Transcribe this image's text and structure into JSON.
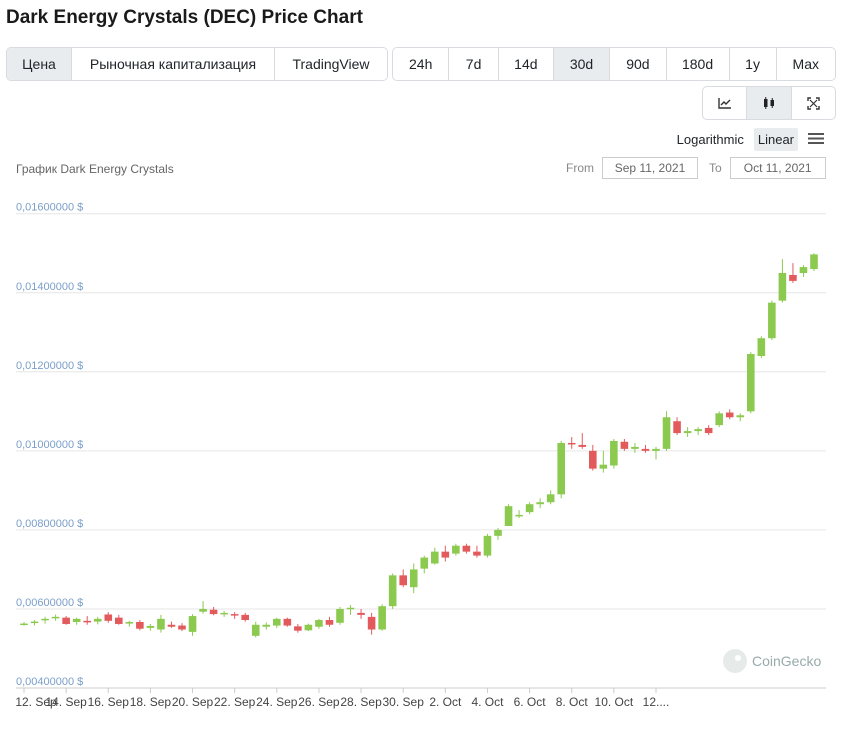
{
  "page": {
    "title": "Dark Energy Crystals (DEC) Price Chart"
  },
  "toolbar": {
    "data_tabs": [
      {
        "label": "Цена",
        "active": true
      },
      {
        "label": "Рыночная капитализация",
        "active": false
      },
      {
        "label": "TradingView",
        "active": false
      }
    ],
    "ranges": [
      {
        "label": "24h",
        "active": false
      },
      {
        "label": "7d",
        "active": false
      },
      {
        "label": "14d",
        "active": false
      },
      {
        "label": "30d",
        "active": true
      },
      {
        "label": "90d",
        "active": false
      },
      {
        "label": "180d",
        "active": false
      },
      {
        "label": "1y",
        "active": false
      },
      {
        "label": "Max",
        "active": false
      }
    ],
    "views": [
      {
        "icon": "line-chart-icon",
        "active": false
      },
      {
        "icon": "candlestick-icon",
        "active": true
      },
      {
        "icon": "fullscreen-icon",
        "active": false
      }
    ],
    "scale": {
      "log_label": "Logarithmic",
      "linear_label": "Linear",
      "selected": "Linear"
    }
  },
  "chart_header": {
    "label": "График Dark Energy Crystals",
    "from_label": "From",
    "from_value": "Sep 11, 2021",
    "to_label": "To",
    "to_value": "Oct 11, 2021"
  },
  "watermark": "CoinGecko",
  "colors": {
    "up": "#8cc94f",
    "down": "#e35a5d",
    "grid": "#e6e6e6",
    "axis_label": "#7a9ec9"
  },
  "chart_data": {
    "type": "candlestick",
    "yticks": [
      0.004,
      0.006,
      0.008,
      0.01,
      0.012,
      0.014,
      0.016
    ],
    "ytick_labels": [
      "0,00400000 $",
      "0,00600000 $",
      "0,00800000 $",
      "0,01000000 $",
      "0,01200000 $",
      "0,01400000 $",
      "0,01600000 $"
    ],
    "ylim": [
      0.004,
      0.0166
    ],
    "xticks": [
      {
        "i": 0,
        "label": "12. Sep"
      },
      {
        "i": 4,
        "label": "14. Sep"
      },
      {
        "i": 8,
        "label": "16. Sep"
      },
      {
        "i": 12,
        "label": "18. Sep"
      },
      {
        "i": 16,
        "label": "20. Sep"
      },
      {
        "i": 20,
        "label": "22. Sep"
      },
      {
        "i": 24,
        "label": "24. Sep"
      },
      {
        "i": 28,
        "label": "26. Sep"
      },
      {
        "i": 32,
        "label": "28. Sep"
      },
      {
        "i": 36,
        "label": "30. Sep"
      },
      {
        "i": 40,
        "label": "2. Oct"
      },
      {
        "i": 44,
        "label": "4. Oct"
      },
      {
        "i": 48,
        "label": "6. Oct"
      },
      {
        "i": 52,
        "label": "8. Oct"
      },
      {
        "i": 56,
        "label": "10. Oct"
      },
      {
        "i": 60,
        "label": "12...."
      }
    ],
    "candles": [
      {
        "o": 0.00563,
        "h": 0.00567,
        "l": 0.00558,
        "c": 0.00563
      },
      {
        "o": 0.00566,
        "h": 0.00572,
        "l": 0.00558,
        "c": 0.00568
      },
      {
        "o": 0.00572,
        "h": 0.0058,
        "l": 0.00563,
        "c": 0.00575
      },
      {
        "o": 0.0058,
        "h": 0.00586,
        "l": 0.0057,
        "c": 0.0058
      },
      {
        "o": 0.00578,
        "h": 0.00582,
        "l": 0.0056,
        "c": 0.00562
      },
      {
        "o": 0.00567,
        "h": 0.00578,
        "l": 0.0056,
        "c": 0.00575
      },
      {
        "o": 0.0057,
        "h": 0.00582,
        "l": 0.0056,
        "c": 0.00566
      },
      {
        "o": 0.00568,
        "h": 0.0058,
        "l": 0.00561,
        "c": 0.00575
      },
      {
        "o": 0.00586,
        "h": 0.00592,
        "l": 0.00565,
        "c": 0.0057
      },
      {
        "o": 0.00578,
        "h": 0.00585,
        "l": 0.0056,
        "c": 0.00562
      },
      {
        "o": 0.00563,
        "h": 0.0057,
        "l": 0.00555,
        "c": 0.00567
      },
      {
        "o": 0.00567,
        "h": 0.00572,
        "l": 0.00546,
        "c": 0.0055
      },
      {
        "o": 0.00552,
        "h": 0.00562,
        "l": 0.00545,
        "c": 0.00557
      },
      {
        "o": 0.00548,
        "h": 0.00585,
        "l": 0.0054,
        "c": 0.00575
      },
      {
        "o": 0.0056,
        "h": 0.00568,
        "l": 0.00552,
        "c": 0.00555
      },
      {
        "o": 0.00558,
        "h": 0.00564,
        "l": 0.00544,
        "c": 0.00548
      },
      {
        "o": 0.00542,
        "h": 0.00587,
        "l": 0.00532,
        "c": 0.00582
      },
      {
        "o": 0.00593,
        "h": 0.0062,
        "l": 0.00588,
        "c": 0.006
      },
      {
        "o": 0.00598,
        "h": 0.00605,
        "l": 0.00584,
        "c": 0.00587
      },
      {
        "o": 0.00589,
        "h": 0.00595,
        "l": 0.0058,
        "c": 0.0059
      },
      {
        "o": 0.00587,
        "h": 0.00592,
        "l": 0.00575,
        "c": 0.00585
      },
      {
        "o": 0.00585,
        "h": 0.0059,
        "l": 0.00568,
        "c": 0.00572
      },
      {
        "o": 0.00532,
        "h": 0.00568,
        "l": 0.00528,
        "c": 0.0056
      },
      {
        "o": 0.00555,
        "h": 0.00566,
        "l": 0.00548,
        "c": 0.0056
      },
      {
        "o": 0.00558,
        "h": 0.00578,
        "l": 0.00552,
        "c": 0.00575
      },
      {
        "o": 0.00575,
        "h": 0.00578,
        "l": 0.00555,
        "c": 0.00558
      },
      {
        "o": 0.00556,
        "h": 0.00562,
        "l": 0.0054,
        "c": 0.00545
      },
      {
        "o": 0.00546,
        "h": 0.00563,
        "l": 0.00544,
        "c": 0.0056
      },
      {
        "o": 0.00555,
        "h": 0.00575,
        "l": 0.0055,
        "c": 0.00572
      },
      {
        "o": 0.00572,
        "h": 0.0058,
        "l": 0.00555,
        "c": 0.0056
      },
      {
        "o": 0.00565,
        "h": 0.00605,
        "l": 0.0056,
        "c": 0.006
      },
      {
        "o": 0.006,
        "h": 0.0061,
        "l": 0.00585,
        "c": 0.00603
      },
      {
        "o": 0.0059,
        "h": 0.006,
        "l": 0.00575,
        "c": 0.00585
      },
      {
        "o": 0.0058,
        "h": 0.0059,
        "l": 0.00535,
        "c": 0.00548
      },
      {
        "o": 0.00548,
        "h": 0.00612,
        "l": 0.00545,
        "c": 0.00607
      },
      {
        "o": 0.00607,
        "h": 0.0069,
        "l": 0.006,
        "c": 0.00685
      },
      {
        "o": 0.00685,
        "h": 0.007,
        "l": 0.00655,
        "c": 0.0066
      },
      {
        "o": 0.00655,
        "h": 0.00715,
        "l": 0.0064,
        "c": 0.007
      },
      {
        "o": 0.00702,
        "h": 0.00735,
        "l": 0.0069,
        "c": 0.0073
      },
      {
        "o": 0.00715,
        "h": 0.00755,
        "l": 0.00712,
        "c": 0.00745
      },
      {
        "o": 0.00745,
        "h": 0.0076,
        "l": 0.0072,
        "c": 0.0073
      },
      {
        "o": 0.0074,
        "h": 0.00765,
        "l": 0.00735,
        "c": 0.0076
      },
      {
        "o": 0.0076,
        "h": 0.00765,
        "l": 0.0074,
        "c": 0.00745
      },
      {
        "o": 0.00745,
        "h": 0.0076,
        "l": 0.0073,
        "c": 0.00735
      },
      {
        "o": 0.00735,
        "h": 0.0079,
        "l": 0.0073,
        "c": 0.00785
      },
      {
        "o": 0.00785,
        "h": 0.00805,
        "l": 0.00775,
        "c": 0.008
      },
      {
        "o": 0.0081,
        "h": 0.00865,
        "l": 0.0081,
        "c": 0.0086
      },
      {
        "o": 0.00835,
        "h": 0.0085,
        "l": 0.0083,
        "c": 0.00838
      },
      {
        "o": 0.00845,
        "h": 0.0087,
        "l": 0.0084,
        "c": 0.00865
      },
      {
        "o": 0.00865,
        "h": 0.0088,
        "l": 0.00855,
        "c": 0.0087
      },
      {
        "o": 0.0087,
        "h": 0.009,
        "l": 0.00865,
        "c": 0.0089
      },
      {
        "o": 0.0089,
        "h": 0.01025,
        "l": 0.0088,
        "c": 0.0102
      },
      {
        "o": 0.0102,
        "h": 0.01035,
        "l": 0.01005,
        "c": 0.01018
      },
      {
        "o": 0.01015,
        "h": 0.01045,
        "l": 0.01005,
        "c": 0.0101
      },
      {
        "o": 0.01,
        "h": 0.01015,
        "l": 0.0095,
        "c": 0.00955
      },
      {
        "o": 0.00955,
        "h": 0.01,
        "l": 0.00945,
        "c": 0.00965
      },
      {
        "o": 0.00963,
        "h": 0.0103,
        "l": 0.00955,
        "c": 0.01025
      },
      {
        "o": 0.01023,
        "h": 0.0103,
        "l": 0.01,
        "c": 0.01005
      },
      {
        "o": 0.01005,
        "h": 0.0102,
        "l": 0.00995,
        "c": 0.0101
      },
      {
        "o": 0.01005,
        "h": 0.01015,
        "l": 0.00995,
        "c": 0.01
      },
      {
        "o": 0.01,
        "h": 0.0101,
        "l": 0.00978,
        "c": 0.01005
      },
      {
        "o": 0.01005,
        "h": 0.011,
        "l": 0.01,
        "c": 0.01085
      },
      {
        "o": 0.01075,
        "h": 0.01085,
        "l": 0.0104,
        "c": 0.01045
      },
      {
        "o": 0.01045,
        "h": 0.0106,
        "l": 0.01035,
        "c": 0.0105
      },
      {
        "o": 0.0105,
        "h": 0.0106,
        "l": 0.0104,
        "c": 0.01055
      },
      {
        "o": 0.01058,
        "h": 0.01065,
        "l": 0.0104,
        "c": 0.01045
      },
      {
        "o": 0.01065,
        "h": 0.011,
        "l": 0.0106,
        "c": 0.01095
      },
      {
        "o": 0.01097,
        "h": 0.01105,
        "l": 0.0108,
        "c": 0.01085
      },
      {
        "o": 0.01085,
        "h": 0.01095,
        "l": 0.01075,
        "c": 0.0109
      },
      {
        "o": 0.011,
        "h": 0.0125,
        "l": 0.01095,
        "c": 0.01245
      },
      {
        "o": 0.0124,
        "h": 0.0129,
        "l": 0.01235,
        "c": 0.01285
      },
      {
        "o": 0.01285,
        "h": 0.0138,
        "l": 0.0128,
        "c": 0.01375
      },
      {
        "o": 0.0138,
        "h": 0.01485,
        "l": 0.01375,
        "c": 0.0145
      },
      {
        "o": 0.01445,
        "h": 0.01475,
        "l": 0.01425,
        "c": 0.0143
      },
      {
        "o": 0.0145,
        "h": 0.0147,
        "l": 0.0144,
        "c": 0.01465
      },
      {
        "o": 0.0146,
        "h": 0.015,
        "l": 0.01455,
        "c": 0.01497
      }
    ]
  }
}
